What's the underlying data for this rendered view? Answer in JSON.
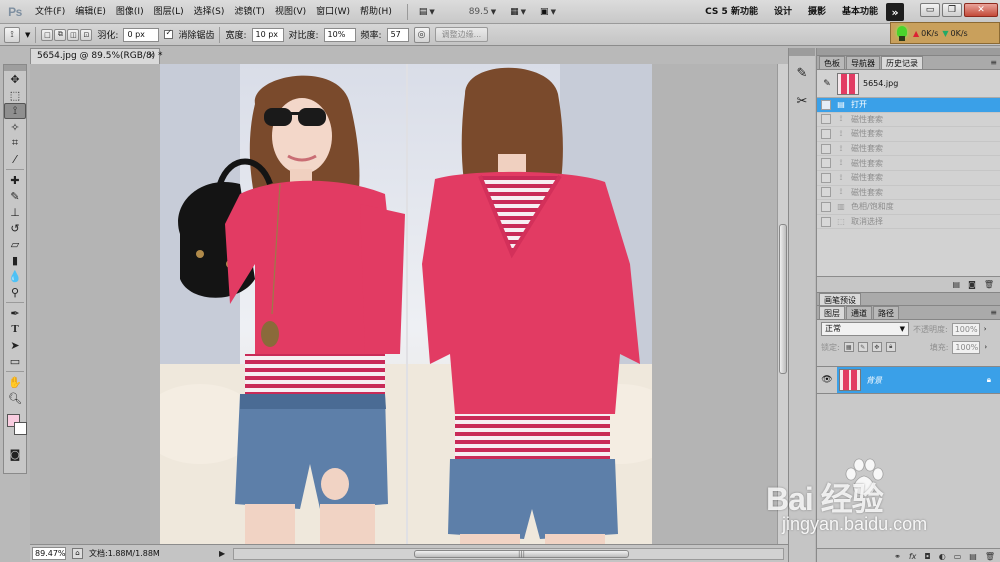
{
  "app": {
    "logo": "Ps"
  },
  "menu": [
    "文件(F)",
    "编辑(E)",
    "图像(I)",
    "图层(L)",
    "选择(S)",
    "滤镜(T)",
    "视图(V)",
    "窗口(W)",
    "帮助(H)"
  ],
  "menu_tools": {
    "zoom": "89.5"
  },
  "workspaces": [
    "CS 5 新功能",
    "设计",
    "摄影",
    "基本功能"
  ],
  "net_widget": {
    "upload": "0K/s",
    "download": "0K/s"
  },
  "options": {
    "feather_label": "羽化:",
    "feather_value": "0 px",
    "antialias_label": "消除锯齿",
    "antialias_checked": true,
    "width_label": "宽度:",
    "width_value": "10 px",
    "contrast_label": "对比度:",
    "contrast_value": "10%",
    "frequency_label": "频率:",
    "frequency_value": "57",
    "refine_edge": "调整边缘..."
  },
  "document": {
    "tab_title": "5654.jpg @ 89.5%(RGB/8) *",
    "status_zoom": "89.47%",
    "doc_size": "文档:1.88M/1.88M"
  },
  "history_panel": {
    "tabs": [
      "色板",
      "导航器",
      "历史记录"
    ],
    "active_tab": "历史记录",
    "snapshot_name": "5654.jpg",
    "items": [
      {
        "label": "打开",
        "current": true
      },
      {
        "label": "磁性套索",
        "current": false
      },
      {
        "label": "磁性套索",
        "current": false
      },
      {
        "label": "磁性套索",
        "current": false
      },
      {
        "label": "磁性套索",
        "current": false
      },
      {
        "label": "磁性套索",
        "current": false
      },
      {
        "label": "磁性套索",
        "current": false
      },
      {
        "label": "色相/饱和度",
        "current": false
      },
      {
        "label": "取消选择",
        "current": false
      }
    ]
  },
  "brush_panel": {
    "title": "画笔预设"
  },
  "layers_panel": {
    "tabs": [
      "图层",
      "通道",
      "路径"
    ],
    "active_tab": "图层",
    "blend_mode": "正常",
    "opacity_label": "不透明度:",
    "opacity_value": "100%",
    "lock_label": "锁定:",
    "fill_label": "填充:",
    "fill_value": "100%",
    "layer_name": "背景"
  },
  "watermark": {
    "text": "Bai 经验",
    "url": "jingyan.baidu.com"
  },
  "colors": {
    "foreground": "#f9cde0",
    "background": "#ffffff",
    "selection": "#3aa0e8",
    "shirt": "#e23b63"
  }
}
